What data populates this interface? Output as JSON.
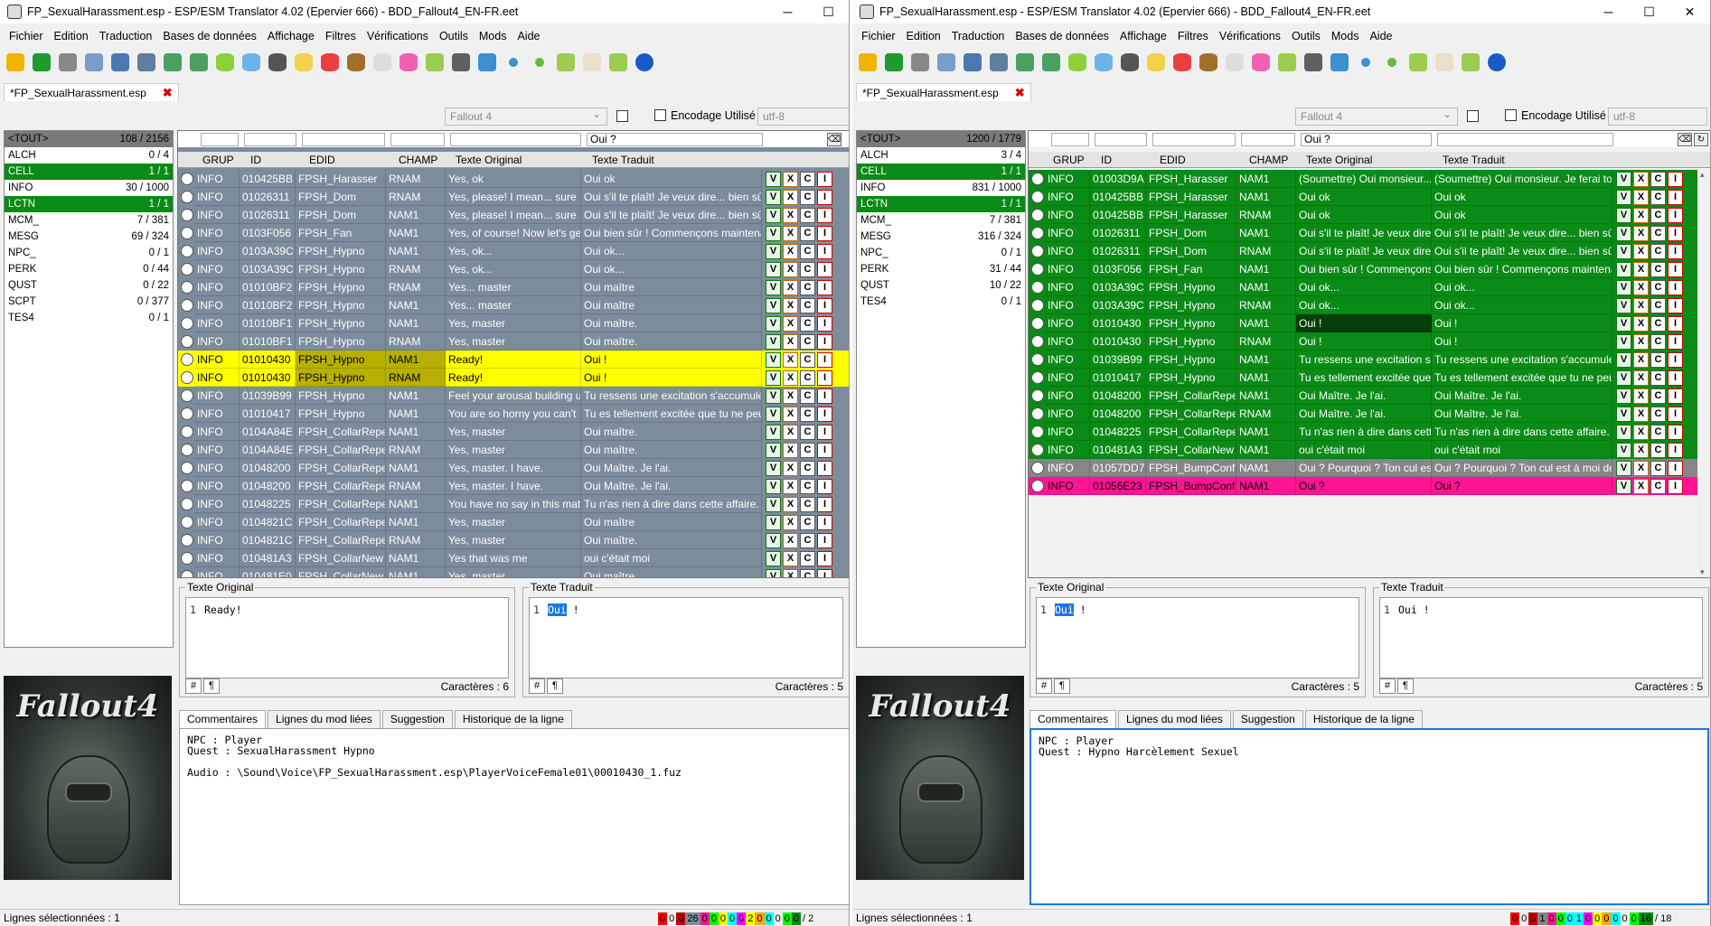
{
  "menus": [
    "Fichier",
    "Edition",
    "Traduction",
    "Bases de données",
    "Affichage",
    "Filtres",
    "Vérifications",
    "Outils",
    "Mods",
    "Aide"
  ],
  "colors": {
    "accent_green": "#0a8a16",
    "highlight_yellow": "#ffff00",
    "highlight_pink": "#ff1493",
    "row_blue": "#7c8c9c",
    "untranslated_gray": "#868686"
  },
  "toolbar_icons": [
    "open-folder-icon",
    "go-icon",
    "gear-icon",
    "compare-icon",
    "search-translate-icon",
    "save-icon",
    "import-icon",
    "export-icon",
    "db-green-icon",
    "db-blue-icon",
    "db-dark-icon",
    "db-yellow-icon",
    "db-red-icon",
    "db-brown-icon",
    "db-white-icon",
    "db-pink-icon",
    "note-icon",
    "wizard-icon",
    "spellcheck-icon",
    "blue-dot-icon",
    "green-dot-icon",
    "plugin-icon",
    "book-icon",
    "cube-icon",
    "play-icon"
  ],
  "left": {
    "title": "FP_SexualHarassment.esp - ESP/ESM Translator 4.02 (Epervier 666) - BDD_Fallout4_EN-FR.eet",
    "file_tab": "*FP_SexualHarassment.esp",
    "game": "Fallout 4",
    "encoding_label": "Encodage Utilisé",
    "encoding": "utf-8",
    "filter_text": "Oui ?",
    "categories": [
      {
        "name": "<TOUT>",
        "count": "108 / 2156",
        "state": "hdr"
      },
      {
        "name": "ALCH",
        "count": "0 / 4",
        "state": ""
      },
      {
        "name": "CELL",
        "count": "1 / 1",
        "state": "sel"
      },
      {
        "name": "INFO",
        "count": "30 / 1000",
        "state": ""
      },
      {
        "name": "LCTN",
        "count": "1 / 1",
        "state": "sel"
      },
      {
        "name": "MCM_",
        "count": "7 / 381",
        "state": ""
      },
      {
        "name": "MESG",
        "count": "69 / 324",
        "state": ""
      },
      {
        "name": "NPC_",
        "count": "0 / 1",
        "state": ""
      },
      {
        "name": "PERK",
        "count": "0 / 44",
        "state": ""
      },
      {
        "name": "QUST",
        "count": "0 / 22",
        "state": ""
      },
      {
        "name": "SCPT",
        "count": "0 / 377",
        "state": ""
      },
      {
        "name": "TES4",
        "count": "0 / 1",
        "state": ""
      }
    ],
    "columns": [
      "GRUP",
      "ID",
      "EDID",
      "CHAMP",
      "Texte Original",
      "Texte Traduit"
    ],
    "rows": [
      {
        "grup": "INFO",
        "id": "010425BB",
        "edid": "FPSH_Harasser",
        "champ": "RNAM",
        "orig": "Yes, ok",
        "trad": "Oui ok",
        "st": "blue"
      },
      {
        "grup": "INFO",
        "id": "01026311",
        "edid": "FPSH_Dom",
        "champ": "RNAM",
        "orig": "Yes, please! I mean... sure",
        "trad": "Oui s'il te plaît! Je veux dire... bien sûr",
        "st": "blue"
      },
      {
        "grup": "INFO",
        "id": "01026311",
        "edid": "FPSH_Dom",
        "champ": "NAM1",
        "orig": "Yes, please! I mean... sure",
        "trad": "Oui s'il te plaît! Je veux dire... bien sûr",
        "st": "blue"
      },
      {
        "grup": "INFO",
        "id": "0103F056",
        "edid": "FPSH_Fan",
        "champ": "NAM1",
        "orig": "Yes, of course! Now let's get",
        "trad": "Oui bien sûr ! Commençons maintenant",
        "st": "blue"
      },
      {
        "grup": "INFO",
        "id": "0103A39C",
        "edid": "FPSH_Hypno",
        "champ": "NAM1",
        "orig": "Yes, ok...",
        "trad": "Oui ok...",
        "st": "blue"
      },
      {
        "grup": "INFO",
        "id": "0103A39C",
        "edid": "FPSH_Hypno",
        "champ": "RNAM",
        "orig": "Yes, ok...",
        "trad": "Oui ok...",
        "st": "blue"
      },
      {
        "grup": "INFO",
        "id": "01010BF2",
        "edid": "FPSH_Hypno",
        "champ": "RNAM",
        "orig": "Yes... master",
        "trad": "Oui maître",
        "st": "blue"
      },
      {
        "grup": "INFO",
        "id": "01010BF2",
        "edid": "FPSH_Hypno",
        "champ": "NAM1",
        "orig": "Yes... master",
        "trad": "Oui maître",
        "st": "blue"
      },
      {
        "grup": "INFO",
        "id": "01010BF1",
        "edid": "FPSH_Hypno",
        "champ": "NAM1",
        "orig": "Yes, master",
        "trad": "Oui maître.",
        "st": "blue"
      },
      {
        "grup": "INFO",
        "id": "01010BF1",
        "edid": "FPSH_Hypno",
        "champ": "RNAM",
        "orig": "Yes, master",
        "trad": "Oui maître.",
        "st": "blue"
      },
      {
        "grup": "INFO",
        "id": "01010430",
        "edid": "FPSH_Hypno",
        "champ": "NAM1",
        "orig": "Ready!",
        "trad": "Oui !",
        "st": "yel"
      },
      {
        "grup": "INFO",
        "id": "01010430",
        "edid": "FPSH_Hypno",
        "champ": "RNAM",
        "orig": "Ready!",
        "trad": "Oui !",
        "st": "yel"
      },
      {
        "grup": "INFO",
        "id": "01039B99",
        "edid": "FPSH_Hypno",
        "champ": "NAM1",
        "orig": "Feel your arousal building up",
        "trad": "Tu ressens une excitation s'accumuler",
        "st": "blue"
      },
      {
        "grup": "INFO",
        "id": "01010417",
        "edid": "FPSH_Hypno",
        "champ": "NAM1",
        "orig": "You are so horny you can't",
        "trad": "Tu es tellement excitée que tu ne peux",
        "st": "blue"
      },
      {
        "grup": "INFO",
        "id": "0104A84E",
        "edid": "FPSH_CollarRepea",
        "champ": "NAM1",
        "orig": "Yes, master",
        "trad": "Oui maître.",
        "st": "blue"
      },
      {
        "grup": "INFO",
        "id": "0104A84E",
        "edid": "FPSH_CollarRepea",
        "champ": "RNAM",
        "orig": "Yes, master",
        "trad": "Oui maître.",
        "st": "blue"
      },
      {
        "grup": "INFO",
        "id": "01048200",
        "edid": "FPSH_CollarRepea",
        "champ": "NAM1",
        "orig": "Yes, master. I have.",
        "trad": "Oui Maître. Je l'ai.",
        "st": "blue"
      },
      {
        "grup": "INFO",
        "id": "01048200",
        "edid": "FPSH_CollarRepea",
        "champ": "RNAM",
        "orig": "Yes, master. I have.",
        "trad": "Oui Maître. Je l'ai.",
        "st": "blue"
      },
      {
        "grup": "INFO",
        "id": "01048225",
        "edid": "FPSH_CollarRepea",
        "champ": "NAM1",
        "orig": "You have no say in this matter",
        "trad": "Tu n'as rien à dire dans cette affaire.",
        "st": "blue"
      },
      {
        "grup": "INFO",
        "id": "0104821C",
        "edid": "FPSH_CollarRepea",
        "champ": "NAM1",
        "orig": "Yes, master",
        "trad": "Oui maître",
        "st": "blue"
      },
      {
        "grup": "INFO",
        "id": "0104821C",
        "edid": "FPSH_CollarRepea",
        "champ": "RNAM",
        "orig": "Yes, master",
        "trad": "Oui maître.",
        "st": "blue"
      },
      {
        "grup": "INFO",
        "id": "010481A3",
        "edid": "FPSH_CollarNew",
        "champ": "NAM1",
        "orig": "Yes that was me",
        "trad": "oui c'était moi",
        "st": "blue"
      },
      {
        "grup": "INFO",
        "id": "010481E0",
        "edid": "FPSH_CollarNew",
        "champ": "NAM1",
        "orig": "Yes, master",
        "trad": "Oui maître",
        "st": "blue"
      }
    ],
    "editor": {
      "orig_label": "Texte Original",
      "orig_line": "1",
      "orig_text": "Ready!",
      "orig_count": "Caractères : 6",
      "trad_label": "Texte Traduit",
      "trad_line": "1",
      "trad_hl": "Oui",
      "trad_rest": " !",
      "trad_count": "Caractères : 5"
    },
    "tabs": [
      "Commentaires",
      "Lignes du mod liées",
      "Suggestion",
      "Historique de la ligne"
    ],
    "comment": "NPC : Player\nQuest : SexualHarassment Hypno\n\nAudio : \\Sound\\Voice\\FP_SexualHarassment.esp\\PlayerVoiceFemale01\\00010430_1.fuz",
    "status": "Lignes sélectionnées : 1",
    "counters": [
      {
        "v": "0",
        "c": "#ff0000"
      },
      {
        "v": "0",
        "c": "#f0f0f0"
      },
      {
        "v": "0",
        "c": "#c00000"
      },
      {
        "v": "26",
        "c": "#7c8c9c"
      },
      {
        "v": "0",
        "c": "#ff1493"
      },
      {
        "v": "0",
        "c": "#00ff00"
      },
      {
        "v": "0",
        "c": "#ffff00"
      },
      {
        "v": "0",
        "c": "#00ffff"
      },
      {
        "v": "0",
        "c": "#ff00ff"
      },
      {
        "v": "2",
        "c": "#ffff00"
      },
      {
        "v": "0",
        "c": "#ffa500"
      },
      {
        "v": "0",
        "c": "#00ffff"
      },
      {
        "v": "0",
        "c": "#f0f0f0"
      },
      {
        "v": "0",
        "c": "#00ff00"
      },
      {
        "v": "0",
        "c": "#0a8a16"
      },
      {
        "v": "/ 2",
        "c": "#f0f0f0"
      }
    ]
  },
  "right": {
    "title": "FP_SexualHarassment.esp - ESP/ESM Translator 4.02 (Epervier 666) - BDD_Fallout4_EN-FR.eet",
    "file_tab": "*FP_SexualHarassment.esp",
    "game": "Fallout 4",
    "encoding_label": "Encodage Utilisé",
    "encoding": "utf-8",
    "filter_text": "Oui ?",
    "categories": [
      {
        "name": "<TOUT>",
        "count": "1200 / 1779",
        "state": "hdr"
      },
      {
        "name": "ALCH",
        "count": "3 / 4",
        "state": ""
      },
      {
        "name": "CELL",
        "count": "1 / 1",
        "state": "sel"
      },
      {
        "name": "INFO",
        "count": "831 / 1000",
        "state": ""
      },
      {
        "name": "LCTN",
        "count": "1 / 1",
        "state": "sel"
      },
      {
        "name": "MCM_",
        "count": "7 / 381",
        "state": ""
      },
      {
        "name": "MESG",
        "count": "316 / 324",
        "state": ""
      },
      {
        "name": "NPC_",
        "count": "0 / 1",
        "state": ""
      },
      {
        "name": "PERK",
        "count": "31 / 44",
        "state": ""
      },
      {
        "name": "QUST",
        "count": "10 / 22",
        "state": ""
      },
      {
        "name": "TES4",
        "count": "0 / 1",
        "state": ""
      }
    ],
    "columns": [
      "GRUP",
      "ID",
      "EDID",
      "CHAMP",
      "Texte Original",
      "Texte Traduit"
    ],
    "rows": [
      {
        "grup": "INFO",
        "id": "01003D9A",
        "edid": "FPSH_Harasser",
        "champ": "NAM1",
        "orig": "(Soumettre) Oui monsieur...",
        "trad": "(Soumettre) Oui monsieur. Je ferai tout",
        "st": "grn"
      },
      {
        "grup": "INFO",
        "id": "010425BB",
        "edid": "FPSH_Harasser",
        "champ": "NAM1",
        "orig": "Oui ok",
        "trad": "Oui ok",
        "st": "grn"
      },
      {
        "grup": "INFO",
        "id": "010425BB",
        "edid": "FPSH_Harasser",
        "champ": "RNAM",
        "orig": "Oui ok",
        "trad": "Oui ok",
        "st": "grn"
      },
      {
        "grup": "INFO",
        "id": "01026311",
        "edid": "FPSH_Dom",
        "champ": "NAM1",
        "orig": "Oui s'il te plaît! Je veux dire",
        "trad": "Oui s'il te plaît! Je veux dire... bien sûr",
        "st": "grn"
      },
      {
        "grup": "INFO",
        "id": "01026311",
        "edid": "FPSH_Dom",
        "champ": "RNAM",
        "orig": "Oui s'il te plaît! Je veux dire",
        "trad": "Oui s'il te plaît! Je veux dire... bien sûr",
        "st": "grn"
      },
      {
        "grup": "INFO",
        "id": "0103F056",
        "edid": "FPSH_Fan",
        "champ": "NAM1",
        "orig": "Oui bien sûr ! Commençons",
        "trad": "Oui bien sûr ! Commençons maintenant",
        "st": "grn"
      },
      {
        "grup": "INFO",
        "id": "0103A39C",
        "edid": "FPSH_Hypno",
        "champ": "NAM1",
        "orig": "Oui ok...",
        "trad": "Oui ok...",
        "st": "grn"
      },
      {
        "grup": "INFO",
        "id": "0103A39C",
        "edid": "FPSH_Hypno",
        "champ": "RNAM",
        "orig": "Oui ok...",
        "trad": "Oui ok...",
        "st": "grn"
      },
      {
        "grup": "INFO",
        "id": "01010430",
        "edid": "FPSH_Hypno",
        "champ": "NAM1",
        "orig": "Oui !",
        "trad": "Oui !",
        "st": "grn",
        "dark": true
      },
      {
        "grup": "INFO",
        "id": "01010430",
        "edid": "FPSH_Hypno",
        "champ": "RNAM",
        "orig": "Oui !",
        "trad": "Oui !",
        "st": "grn"
      },
      {
        "grup": "INFO",
        "id": "01039B99",
        "edid": "FPSH_Hypno",
        "champ": "NAM1",
        "orig": "Tu ressens une excitation s'a",
        "trad": "Tu ressens une excitation s'accumuler",
        "st": "grn"
      },
      {
        "grup": "INFO",
        "id": "01010417",
        "edid": "FPSH_Hypno",
        "champ": "NAM1",
        "orig": "Tu es tellement excitée que",
        "trad": "Tu es tellement excitée que tu ne peux",
        "st": "grn"
      },
      {
        "grup": "INFO",
        "id": "01048200",
        "edid": "FPSH_CollarRepea",
        "champ": "NAM1",
        "orig": "Oui Maître. Je l'ai.",
        "trad": "Oui Maître. Je l'ai.",
        "st": "grn"
      },
      {
        "grup": "INFO",
        "id": "01048200",
        "edid": "FPSH_CollarRepea",
        "champ": "RNAM",
        "orig": "Oui Maître. Je l'ai.",
        "trad": "Oui Maître. Je l'ai.",
        "st": "grn"
      },
      {
        "grup": "INFO",
        "id": "01048225",
        "edid": "FPSH_CollarRepea",
        "champ": "NAM1",
        "orig": "Tu n'as rien à dire dans cette",
        "trad": "Tu n'as rien à dire dans cette affaire.",
        "st": "grn"
      },
      {
        "grup": "INFO",
        "id": "010481A3",
        "edid": "FPSH_CollarNew",
        "champ": "NAM1",
        "orig": "oui c'était moi",
        "trad": "oui c'était moi",
        "st": "grn"
      },
      {
        "grup": "INFO",
        "id": "01057DD7",
        "edid": "FPSH_BumpConfro",
        "champ": "NAM1",
        "orig": "Oui ? Pourquoi ? Ton cul est",
        "trad": "Oui ? Pourquoi ? Ton cul est à moi de",
        "st": "gry"
      },
      {
        "grup": "INFO",
        "id": "01056E23",
        "edid": "FPSH_BumpConfro",
        "champ": "NAM1",
        "orig": "Oui ?",
        "trad": "Oui ?",
        "st": "pnk"
      }
    ],
    "editor": {
      "orig_label": "Texte Original",
      "orig_line": "1",
      "orig_hl": "Oui",
      "orig_rest": " !",
      "orig_count": "Caractères : 5",
      "trad_label": "Texte Traduit",
      "trad_line": "1",
      "trad_text": "Oui !",
      "trad_count": "Caractères : 5"
    },
    "tabs": [
      "Commentaires",
      "Lignes du mod liées",
      "Suggestion",
      "Historique de la ligne"
    ],
    "comment": "NPC : Player\nQuest : Hypno Harcèlement Sexuel",
    "status": "Lignes sélectionnées : 1",
    "counters": [
      {
        "v": "0",
        "c": "#ff0000"
      },
      {
        "v": "0",
        "c": "#f0f0f0"
      },
      {
        "v": "0",
        "c": "#c00000"
      },
      {
        "v": "1",
        "c": "#868686"
      },
      {
        "v": "0",
        "c": "#ff1493"
      },
      {
        "v": "0",
        "c": "#00ff00"
      },
      {
        "v": "0",
        "c": "#00ffff"
      },
      {
        "v": "1",
        "c": "#00ffff"
      },
      {
        "v": "0",
        "c": "#ff00ff"
      },
      {
        "v": "0",
        "c": "#ffff00"
      },
      {
        "v": "0",
        "c": "#ffa500"
      },
      {
        "v": "0",
        "c": "#00ffff"
      },
      {
        "v": "0",
        "c": "#f0f0f0"
      },
      {
        "v": "0",
        "c": "#00ff00"
      },
      {
        "v": "16",
        "c": "#0a8a16"
      },
      {
        "v": "/ 18",
        "c": "#f0f0f0"
      }
    ]
  }
}
